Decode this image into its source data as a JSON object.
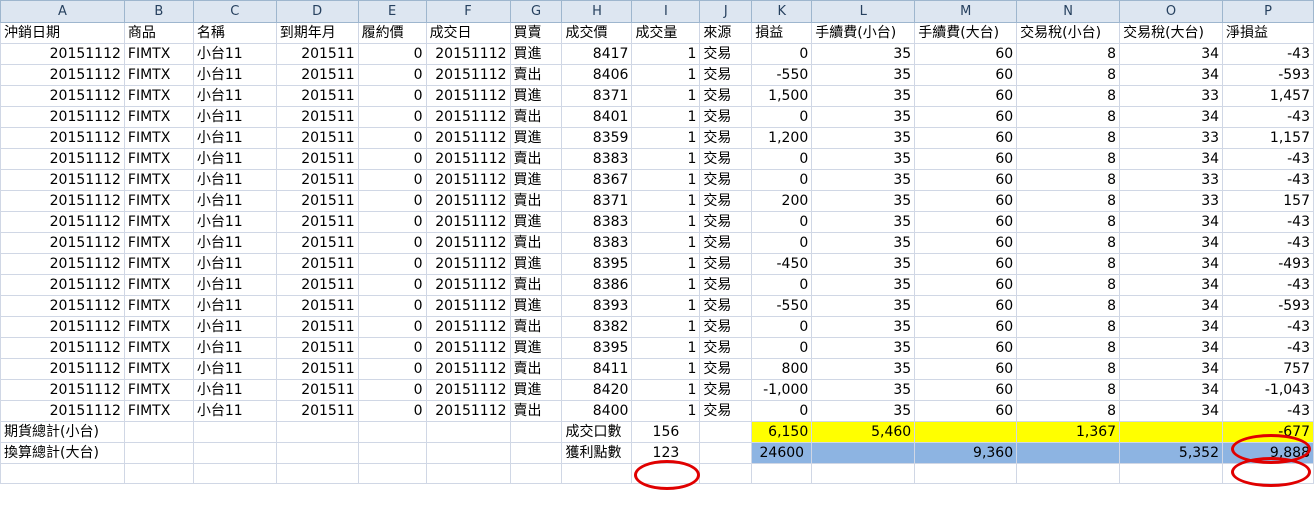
{
  "column_letters": [
    "A",
    "B",
    "C",
    "D",
    "E",
    "F",
    "G",
    "H",
    "I",
    "J",
    "K",
    "L",
    "M",
    "N",
    "O",
    "P"
  ],
  "headers": [
    "沖銷日期",
    "商品",
    "名稱",
    "到期年月",
    "履約價",
    "成交日",
    "買賣",
    "成交價",
    "成交量",
    "來源",
    "損益",
    "手續費(小台)",
    "手續費(大台)",
    "交易稅(小台)",
    "交易稅(大台)",
    "淨損益"
  ],
  "rows": [
    [
      "20151112",
      "FIMTX",
      "小台11",
      "201511",
      "0",
      "20151112",
      "買進",
      "8417",
      "1",
      "交易",
      "0",
      "35",
      "60",
      "8",
      "34",
      "-43"
    ],
    [
      "20151112",
      "FIMTX",
      "小台11",
      "201511",
      "0",
      "20151112",
      "賣出",
      "8406",
      "1",
      "交易",
      "-550",
      "35",
      "60",
      "8",
      "34",
      "-593"
    ],
    [
      "20151112",
      "FIMTX",
      "小台11",
      "201511",
      "0",
      "20151112",
      "買進",
      "8371",
      "1",
      "交易",
      "1,500",
      "35",
      "60",
      "8",
      "33",
      "1,457"
    ],
    [
      "20151112",
      "FIMTX",
      "小台11",
      "201511",
      "0",
      "20151112",
      "賣出",
      "8401",
      "1",
      "交易",
      "0",
      "35",
      "60",
      "8",
      "34",
      "-43"
    ],
    [
      "20151112",
      "FIMTX",
      "小台11",
      "201511",
      "0",
      "20151112",
      "買進",
      "8359",
      "1",
      "交易",
      "1,200",
      "35",
      "60",
      "8",
      "33",
      "1,157"
    ],
    [
      "20151112",
      "FIMTX",
      "小台11",
      "201511",
      "0",
      "20151112",
      "賣出",
      "8383",
      "1",
      "交易",
      "0",
      "35",
      "60",
      "8",
      "34",
      "-43"
    ],
    [
      "20151112",
      "FIMTX",
      "小台11",
      "201511",
      "0",
      "20151112",
      "買進",
      "8367",
      "1",
      "交易",
      "0",
      "35",
      "60",
      "8",
      "33",
      "-43"
    ],
    [
      "20151112",
      "FIMTX",
      "小台11",
      "201511",
      "0",
      "20151112",
      "賣出",
      "8371",
      "1",
      "交易",
      "200",
      "35",
      "60",
      "8",
      "33",
      "157"
    ],
    [
      "20151112",
      "FIMTX",
      "小台11",
      "201511",
      "0",
      "20151112",
      "買進",
      "8383",
      "1",
      "交易",
      "0",
      "35",
      "60",
      "8",
      "34",
      "-43"
    ],
    [
      "20151112",
      "FIMTX",
      "小台11",
      "201511",
      "0",
      "20151112",
      "賣出",
      "8383",
      "1",
      "交易",
      "0",
      "35",
      "60",
      "8",
      "34",
      "-43"
    ],
    [
      "20151112",
      "FIMTX",
      "小台11",
      "201511",
      "0",
      "20151112",
      "買進",
      "8395",
      "1",
      "交易",
      "-450",
      "35",
      "60",
      "8",
      "34",
      "-493"
    ],
    [
      "20151112",
      "FIMTX",
      "小台11",
      "201511",
      "0",
      "20151112",
      "賣出",
      "8386",
      "1",
      "交易",
      "0",
      "35",
      "60",
      "8",
      "34",
      "-43"
    ],
    [
      "20151112",
      "FIMTX",
      "小台11",
      "201511",
      "0",
      "20151112",
      "買進",
      "8393",
      "1",
      "交易",
      "-550",
      "35",
      "60",
      "8",
      "34",
      "-593"
    ],
    [
      "20151112",
      "FIMTX",
      "小台11",
      "201511",
      "0",
      "20151112",
      "賣出",
      "8382",
      "1",
      "交易",
      "0",
      "35",
      "60",
      "8",
      "34",
      "-43"
    ],
    [
      "20151112",
      "FIMTX",
      "小台11",
      "201511",
      "0",
      "20151112",
      "買進",
      "8395",
      "1",
      "交易",
      "0",
      "35",
      "60",
      "8",
      "34",
      "-43"
    ],
    [
      "20151112",
      "FIMTX",
      "小台11",
      "201511",
      "0",
      "20151112",
      "賣出",
      "8411",
      "1",
      "交易",
      "800",
      "35",
      "60",
      "8",
      "34",
      "757"
    ],
    [
      "20151112",
      "FIMTX",
      "小台11",
      "201511",
      "0",
      "20151112",
      "買進",
      "8420",
      "1",
      "交易",
      "-1,000",
      "35",
      "60",
      "8",
      "34",
      "-1,043"
    ],
    [
      "20151112",
      "FIMTX",
      "小台11",
      "201511",
      "0",
      "20151112",
      "賣出",
      "8400",
      "1",
      "交易",
      "0",
      "35",
      "60",
      "8",
      "34",
      "-43"
    ]
  ],
  "summary1": {
    "label": "期貨總計(小台)",
    "count_label": "成交口數",
    "count_value": "156",
    "pnl": "6,150",
    "fee": "5,460",
    "tax": "1,367",
    "net": "-677"
  },
  "summary2": {
    "label": "換算總計(大台)",
    "points_label": "獲利點數",
    "points_value": "123",
    "pnl": "24600",
    "fee": "9,360",
    "tax": "5,352",
    "net": "9,888"
  },
  "colors": {
    "highlight_yellow": "#ffff00",
    "highlight_blue": "#8db4e2",
    "circle_red": "#e00000",
    "header_bg": "#dde6f1"
  }
}
